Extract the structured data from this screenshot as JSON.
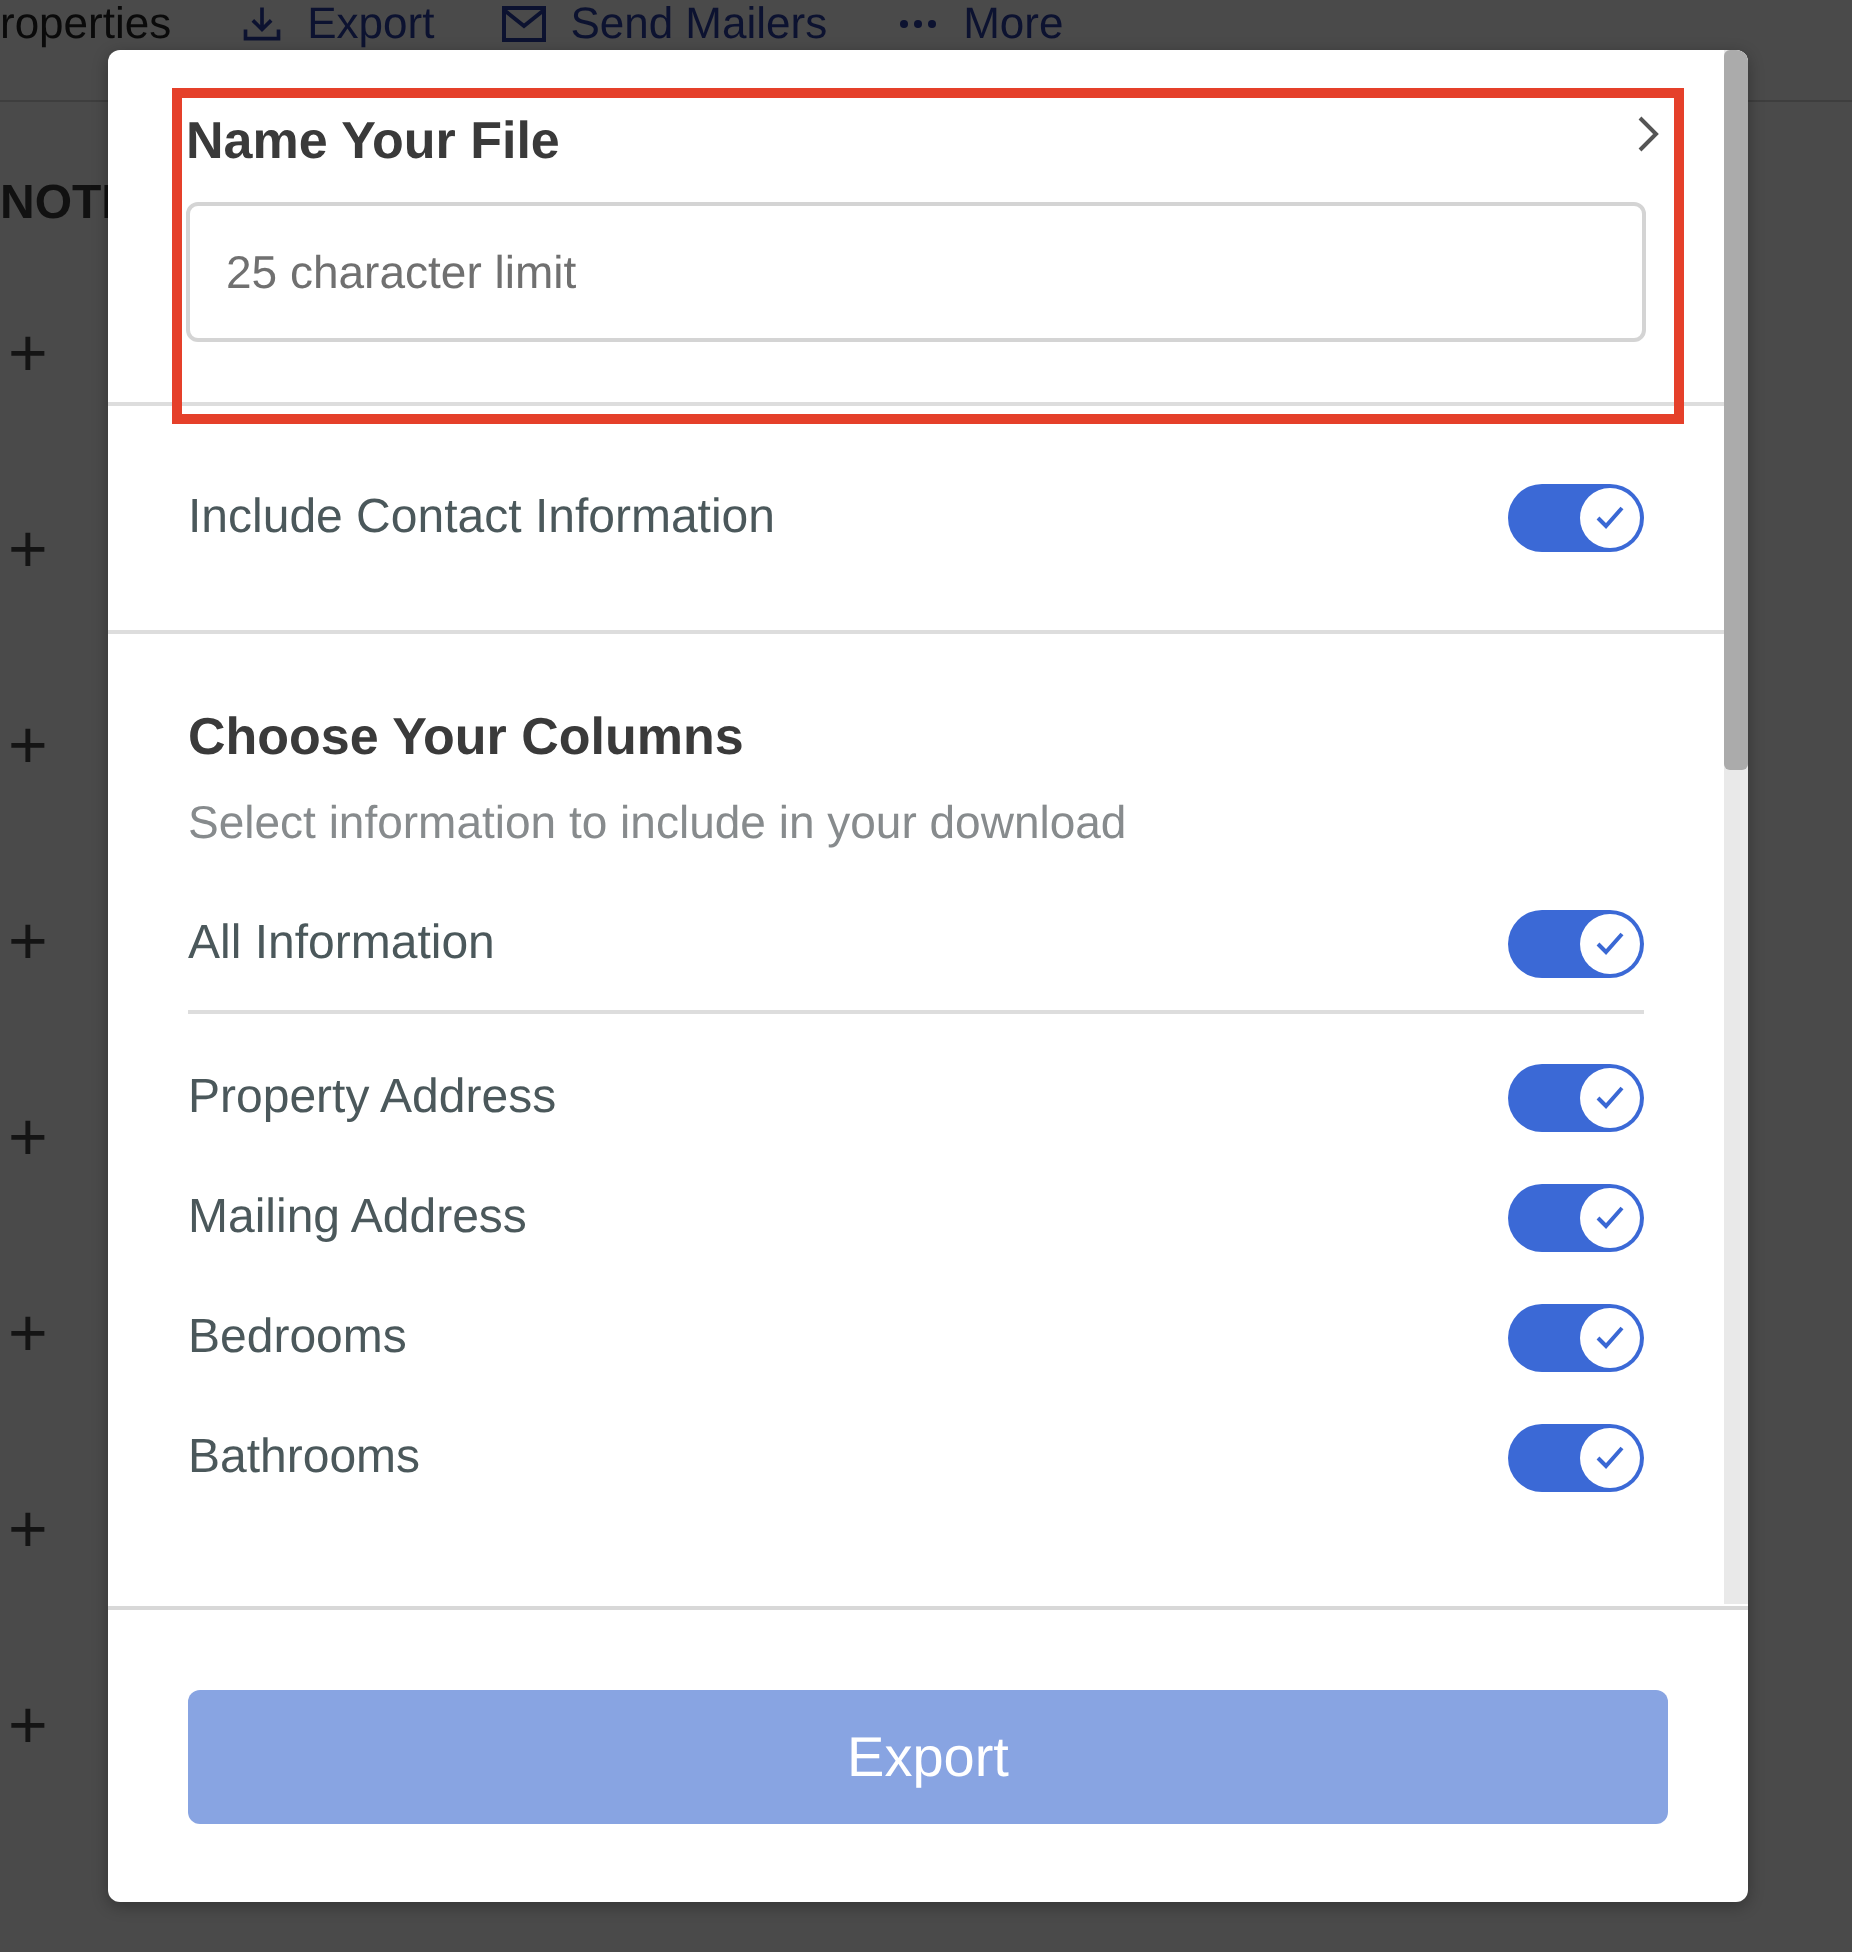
{
  "toolbar": {
    "title": "roperties",
    "actions": [
      {
        "kind": "download",
        "label": "Export"
      },
      {
        "kind": "mail",
        "label": "Send Mailers"
      },
      {
        "kind": "dots",
        "label": "More"
      }
    ]
  },
  "table": {
    "column_header": "NOTI",
    "rows": [
      {
        "action": "+"
      },
      {
        "action": "+"
      },
      {
        "action": "+"
      },
      {
        "action": "+"
      },
      {
        "action": "+"
      },
      {
        "action": "+"
      },
      {
        "action": "+"
      },
      {
        "action": "+"
      }
    ]
  },
  "dialog": {
    "title": "Name Your File",
    "file_name": {
      "placeholder": "25 character limit"
    },
    "contact": {
      "label": "Include Contact Information",
      "on": true
    },
    "columns": {
      "title": "Choose Your Columns",
      "subtitle": "Select information to include in your download",
      "all": {
        "label": "All Information",
        "on": true
      },
      "items": [
        {
          "label": "Property Address",
          "on": true
        },
        {
          "label": "Mailing Address",
          "on": true
        },
        {
          "label": "Bedrooms",
          "on": true
        },
        {
          "label": "Bathrooms",
          "on": true
        }
      ]
    },
    "export_button": {
      "label": "Export",
      "disabled": true
    }
  }
}
